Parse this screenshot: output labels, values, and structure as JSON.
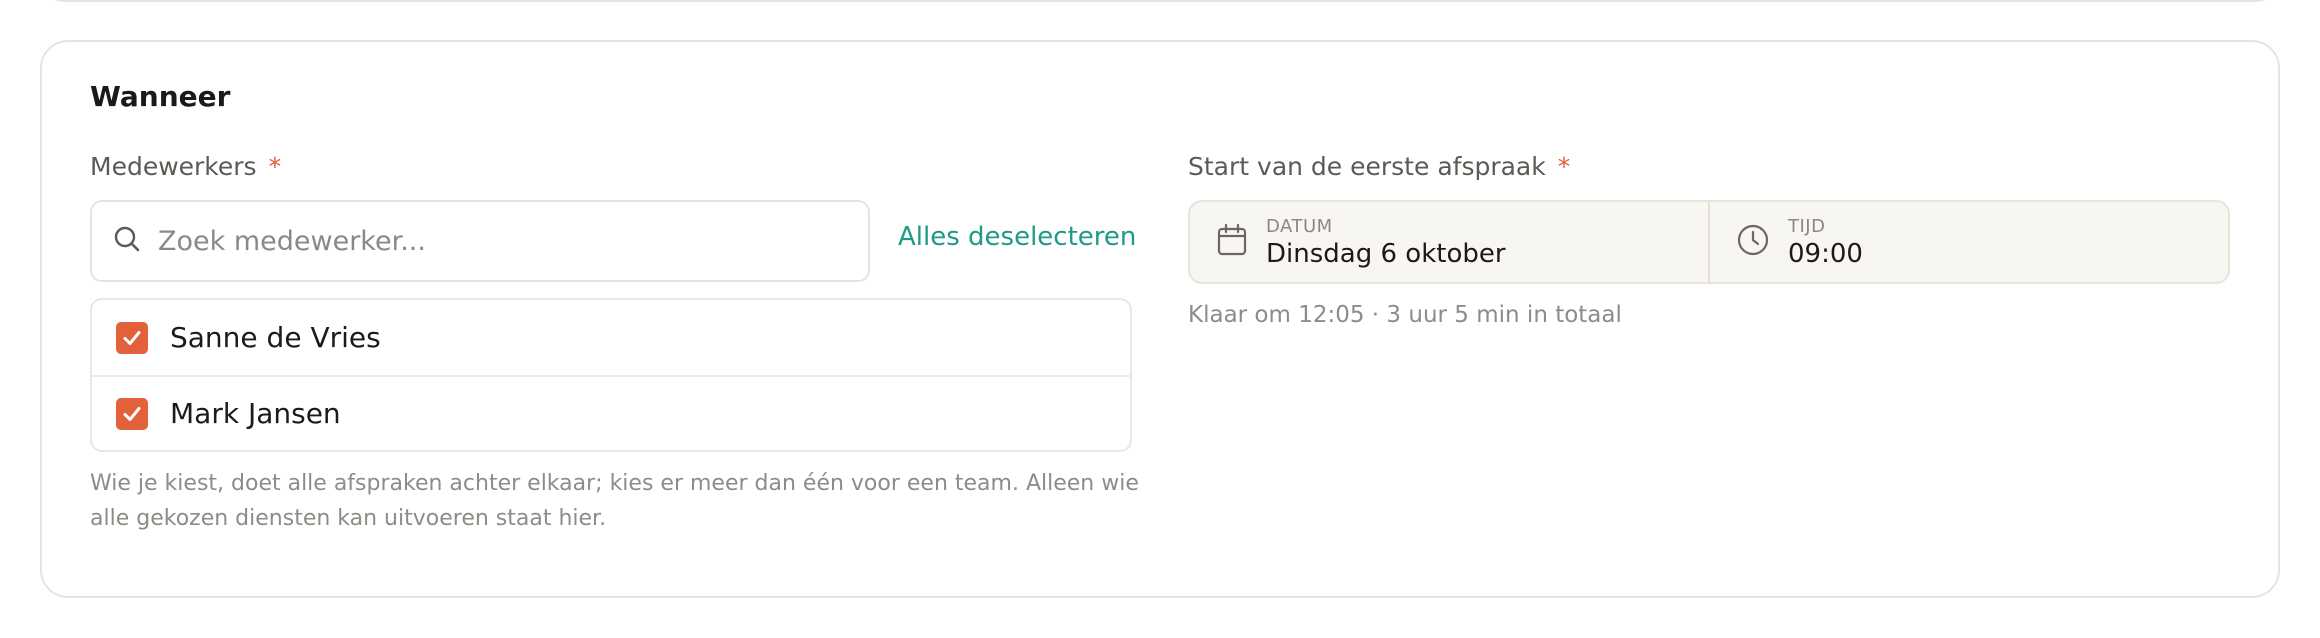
{
  "section": {
    "title": "Wanneer"
  },
  "employees": {
    "label": "Medewerkers",
    "required_marker": "*",
    "search_placeholder": "Zoek medewerker...",
    "deselect_all_label": "Alles deselecteren",
    "items": [
      {
        "name": "Sanne de Vries",
        "checked": true
      },
      {
        "name": "Mark Jansen",
        "checked": true
      }
    ],
    "help_text": "Wie je kiest, doet alle afspraken achter elkaar; kies er meer dan één voor een team. Alleen wie alle gekozen diensten kan uitvoeren staat hier."
  },
  "start": {
    "label": "Start van de eerste afspraak",
    "required_marker": "*",
    "date_caption": "DATUM",
    "date_value": "Dinsdag 6 oktober",
    "time_caption": "TIJD",
    "time_value": "09:00",
    "summary": "Klaar om 12:05 · 3 uur 5 min in totaal"
  },
  "colors": {
    "accent": "#e2603a",
    "link": "#1f9a85"
  }
}
